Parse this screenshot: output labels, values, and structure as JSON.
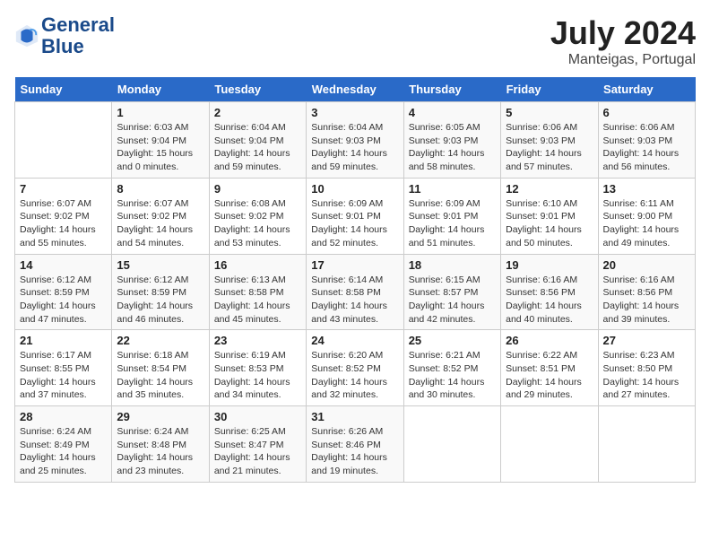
{
  "header": {
    "logo_line1": "General",
    "logo_line2": "Blue",
    "month_year": "July 2024",
    "location": "Manteigas, Portugal"
  },
  "days_of_week": [
    "Sunday",
    "Monday",
    "Tuesday",
    "Wednesday",
    "Thursday",
    "Friday",
    "Saturday"
  ],
  "weeks": [
    [
      {
        "day": "",
        "sunrise": "",
        "sunset": "",
        "daylight": ""
      },
      {
        "day": "1",
        "sunrise": "6:03 AM",
        "sunset": "9:04 PM",
        "daylight": "15 hours and 0 minutes."
      },
      {
        "day": "2",
        "sunrise": "6:04 AM",
        "sunset": "9:04 PM",
        "daylight": "14 hours and 59 minutes."
      },
      {
        "day": "3",
        "sunrise": "6:04 AM",
        "sunset": "9:03 PM",
        "daylight": "14 hours and 59 minutes."
      },
      {
        "day": "4",
        "sunrise": "6:05 AM",
        "sunset": "9:03 PM",
        "daylight": "14 hours and 58 minutes."
      },
      {
        "day": "5",
        "sunrise": "6:06 AM",
        "sunset": "9:03 PM",
        "daylight": "14 hours and 57 minutes."
      },
      {
        "day": "6",
        "sunrise": "6:06 AM",
        "sunset": "9:03 PM",
        "daylight": "14 hours and 56 minutes."
      }
    ],
    [
      {
        "day": "7",
        "sunrise": "6:07 AM",
        "sunset": "9:02 PM",
        "daylight": "14 hours and 55 minutes."
      },
      {
        "day": "8",
        "sunrise": "6:07 AM",
        "sunset": "9:02 PM",
        "daylight": "14 hours and 54 minutes."
      },
      {
        "day": "9",
        "sunrise": "6:08 AM",
        "sunset": "9:02 PM",
        "daylight": "14 hours and 53 minutes."
      },
      {
        "day": "10",
        "sunrise": "6:09 AM",
        "sunset": "9:01 PM",
        "daylight": "14 hours and 52 minutes."
      },
      {
        "day": "11",
        "sunrise": "6:09 AM",
        "sunset": "9:01 PM",
        "daylight": "14 hours and 51 minutes."
      },
      {
        "day": "12",
        "sunrise": "6:10 AM",
        "sunset": "9:01 PM",
        "daylight": "14 hours and 50 minutes."
      },
      {
        "day": "13",
        "sunrise": "6:11 AM",
        "sunset": "9:00 PM",
        "daylight": "14 hours and 49 minutes."
      }
    ],
    [
      {
        "day": "14",
        "sunrise": "6:12 AM",
        "sunset": "8:59 PM",
        "daylight": "14 hours and 47 minutes."
      },
      {
        "day": "15",
        "sunrise": "6:12 AM",
        "sunset": "8:59 PM",
        "daylight": "14 hours and 46 minutes."
      },
      {
        "day": "16",
        "sunrise": "6:13 AM",
        "sunset": "8:58 PM",
        "daylight": "14 hours and 45 minutes."
      },
      {
        "day": "17",
        "sunrise": "6:14 AM",
        "sunset": "8:58 PM",
        "daylight": "14 hours and 43 minutes."
      },
      {
        "day": "18",
        "sunrise": "6:15 AM",
        "sunset": "8:57 PM",
        "daylight": "14 hours and 42 minutes."
      },
      {
        "day": "19",
        "sunrise": "6:16 AM",
        "sunset": "8:56 PM",
        "daylight": "14 hours and 40 minutes."
      },
      {
        "day": "20",
        "sunrise": "6:16 AM",
        "sunset": "8:56 PM",
        "daylight": "14 hours and 39 minutes."
      }
    ],
    [
      {
        "day": "21",
        "sunrise": "6:17 AM",
        "sunset": "8:55 PM",
        "daylight": "14 hours and 37 minutes."
      },
      {
        "day": "22",
        "sunrise": "6:18 AM",
        "sunset": "8:54 PM",
        "daylight": "14 hours and 35 minutes."
      },
      {
        "day": "23",
        "sunrise": "6:19 AM",
        "sunset": "8:53 PM",
        "daylight": "14 hours and 34 minutes."
      },
      {
        "day": "24",
        "sunrise": "6:20 AM",
        "sunset": "8:52 PM",
        "daylight": "14 hours and 32 minutes."
      },
      {
        "day": "25",
        "sunrise": "6:21 AM",
        "sunset": "8:52 PM",
        "daylight": "14 hours and 30 minutes."
      },
      {
        "day": "26",
        "sunrise": "6:22 AM",
        "sunset": "8:51 PM",
        "daylight": "14 hours and 29 minutes."
      },
      {
        "day": "27",
        "sunrise": "6:23 AM",
        "sunset": "8:50 PM",
        "daylight": "14 hours and 27 minutes."
      }
    ],
    [
      {
        "day": "28",
        "sunrise": "6:24 AM",
        "sunset": "8:49 PM",
        "daylight": "14 hours and 25 minutes."
      },
      {
        "day": "29",
        "sunrise": "6:24 AM",
        "sunset": "8:48 PM",
        "daylight": "14 hours and 23 minutes."
      },
      {
        "day": "30",
        "sunrise": "6:25 AM",
        "sunset": "8:47 PM",
        "daylight": "14 hours and 21 minutes."
      },
      {
        "day": "31",
        "sunrise": "6:26 AM",
        "sunset": "8:46 PM",
        "daylight": "14 hours and 19 minutes."
      },
      {
        "day": "",
        "sunrise": "",
        "sunset": "",
        "daylight": ""
      },
      {
        "day": "",
        "sunrise": "",
        "sunset": "",
        "daylight": ""
      },
      {
        "day": "",
        "sunrise": "",
        "sunset": "",
        "daylight": ""
      }
    ]
  ]
}
